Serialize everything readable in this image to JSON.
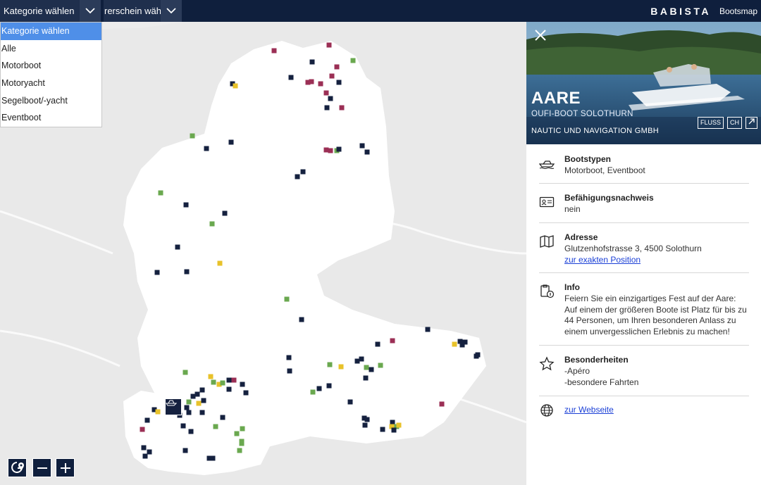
{
  "topbar": {
    "category_select_value": "Kategorie wählen",
    "license_select_value": "rerschein wäh",
    "brand_name": "BABISTA",
    "brand_sub": "Bootsmap",
    "colors": {
      "bar": "#0f1f3d"
    }
  },
  "category_dropdown": {
    "items": [
      "Kategorie wählen",
      "Alle",
      "Motorboot",
      "Motoryacht",
      "Segelboot/-yacht",
      "Eventboot"
    ],
    "selected_index": 0
  },
  "map": {
    "marker_colors": {
      "navy": "#15213f",
      "maroon": "#9b2f55",
      "green": "#6aa84f",
      "yellow": "#e8c22a"
    },
    "controls": [
      "locate-icon",
      "zoom-out-icon",
      "zoom-in-icon"
    ]
  },
  "detail_panel": {
    "title": "AARE",
    "subtitle": "OUFI-BOOT SOLOTHURN",
    "operator": "NAUTIC UND NAVIGATION GMBH",
    "badges": [
      "FLUSS",
      "CH"
    ],
    "sections": {
      "boat_types": {
        "heading": "Bootstypen",
        "value": "Motorboot, Eventboot",
        "icon": "boat-icon"
      },
      "license": {
        "heading": "Befähigungsnachweis",
        "value": "nein",
        "icon": "id-card-icon"
      },
      "address": {
        "heading": "Adresse",
        "value": "Glutzenhofstrasse 3, 4500 Solothurn",
        "link": "zur exakten Position",
        "icon": "map-icon"
      },
      "info": {
        "heading": "Info",
        "value": "Feiern Sie ein einzigartiges Fest auf der Aare: Auf einem der größeren Boote ist Platz für bis zu 44 Personen, um Ihren besonderen Anlass zu einem unvergesslichen Erlebnis zu machen!",
        "icon": "info-clipboard-icon"
      },
      "features": {
        "heading": "Besonderheiten",
        "lines": [
          "-Apéro",
          "-besondere Fahrten"
        ],
        "icon": "star-icon"
      },
      "website": {
        "link": "zur Webseite",
        "icon": "globe-icon"
      }
    }
  }
}
